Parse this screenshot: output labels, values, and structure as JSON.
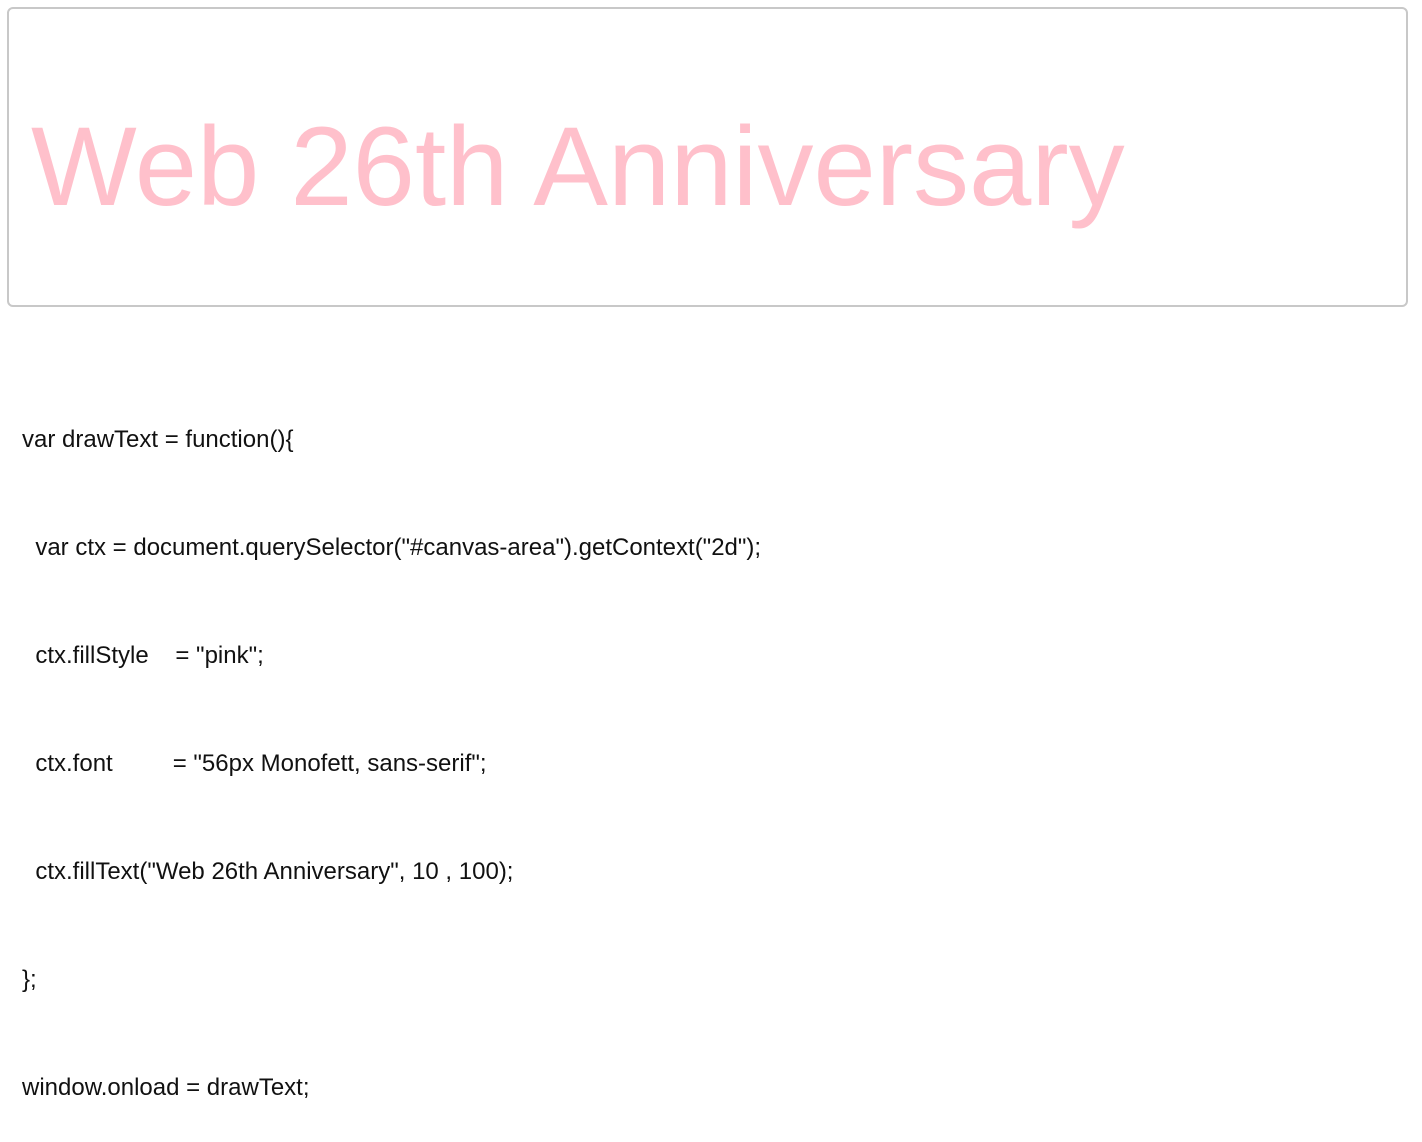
{
  "canvas": {
    "text": "Web 26th Anniversary",
    "fill_color": "#ffc0cb"
  },
  "code": {
    "lines": [
      "var drawText = function(){",
      "  var ctx = document.querySelector(\"#canvas-area\").getContext(\"2d\");",
      "  ctx.fillStyle    = \"pink\";",
      "  ctx.font         = \"56px Monofett, sans-serif\";",
      "  ctx.fillText(\"Web 26th Anniversary\", 10 , 100);",
      "};",
      "window.onload = drawText;"
    ]
  }
}
